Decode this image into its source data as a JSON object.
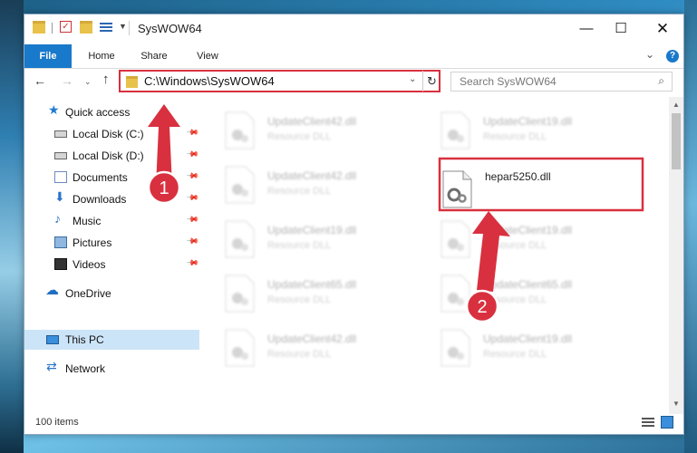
{
  "window": {
    "title": "SysWOW64"
  },
  "window_controls": {
    "minimize": "—",
    "maximize": "☐",
    "close": "✕"
  },
  "ribbon": {
    "tabs": [
      {
        "label": "File"
      },
      {
        "label": "Home"
      },
      {
        "label": "Share"
      },
      {
        "label": "View"
      }
    ],
    "expand_glyph": "⌄",
    "help_glyph": "?"
  },
  "navigation": {
    "back_glyph": "←",
    "forward_glyph": "→",
    "recent_glyph": "⌄",
    "up_glyph": "↑"
  },
  "address": {
    "path": "C:\\Windows\\SysWOW64",
    "dropdown_glyph": "⌄",
    "refresh_glyph": "↻"
  },
  "search": {
    "placeholder": "Search SysWOW64",
    "icon_glyph": "⌕"
  },
  "sidebar": {
    "items": [
      {
        "label": "Quick access",
        "icon": "star-icon",
        "glyph": "★"
      },
      {
        "label": "Local Disk (C:)",
        "icon": "hard-disk-icon",
        "pinned": true
      },
      {
        "label": "Local Disk (D:)",
        "icon": "hard-disk-icon",
        "pinned": true
      },
      {
        "label": "Documents",
        "icon": "documents-icon",
        "pinned": true
      },
      {
        "label": "Downloads",
        "icon": "download-arrow-icon",
        "glyph": "⬇",
        "pinned": true
      },
      {
        "label": "Music",
        "icon": "music-note-icon",
        "glyph": "♪",
        "pinned": true
      },
      {
        "label": "Pictures",
        "icon": "pictures-icon",
        "pinned": true
      },
      {
        "label": "Videos",
        "icon": "film-icon",
        "pinned": true
      },
      {
        "label": "OneDrive",
        "icon": "cloud-icon",
        "glyph": "☁"
      },
      {
        "label": "This PC",
        "icon": "computer-icon",
        "selected": true
      },
      {
        "label": "Network",
        "icon": "network-icon",
        "glyph": "⇄"
      }
    ],
    "pin_glyph": "📌"
  },
  "files": {
    "highlighted": {
      "name": "hepar5250.dll"
    },
    "blurred": [
      {
        "name": "UpdateClient42.dll",
        "type": "Resource DLL"
      },
      {
        "name": "UpdateClient19.dll",
        "type": "Resource DLL"
      },
      {
        "name": "UpdateClient42.dll",
        "type": "Resource DLL"
      },
      {
        "name": "UpdateClient19.dll",
        "type": "Resource DLL"
      },
      {
        "name": "UpdateClient19.dll",
        "type": "Resource DLL"
      },
      {
        "name": "UpdateClient65.dll",
        "type": "Resource DLL"
      },
      {
        "name": "UpdateClient65.dll",
        "type": "Resource DLL"
      },
      {
        "name": "UpdateClient42.dll",
        "type": "Resource DLL"
      },
      {
        "name": "UpdateClient19.dll",
        "type": "Resource DLL"
      }
    ]
  },
  "scrollbar": {
    "up_glyph": "▲",
    "down_glyph": "▼"
  },
  "status": {
    "item_count": "100 items"
  },
  "annotations": {
    "step1": "1",
    "step2": "2",
    "color_red": "#d9303f"
  },
  "colors": {
    "accent": "#1979ca",
    "selected": "#cce4f7"
  }
}
